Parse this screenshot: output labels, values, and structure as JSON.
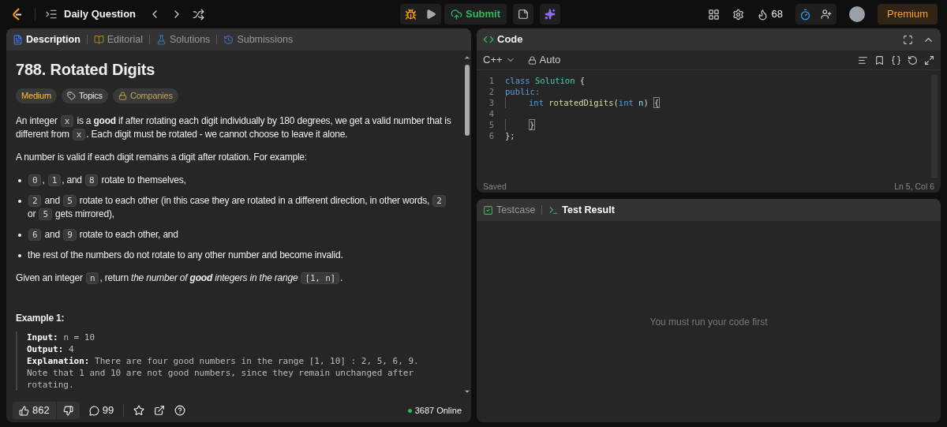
{
  "topbar": {
    "title": "Daily Question",
    "submit": "Submit",
    "streak": "68",
    "premium": "Premium"
  },
  "left_tabs": [
    {
      "kind": "description",
      "label": "Description",
      "selected": true
    },
    {
      "kind": "editorial",
      "label": "Editorial",
      "selected": false
    },
    {
      "kind": "solutions",
      "label": "Solutions",
      "selected": false
    },
    {
      "kind": "submissions",
      "label": "Submissions",
      "selected": false
    }
  ],
  "problem": {
    "title": "788. Rotated Digits",
    "tags": [
      {
        "kind": "difficulty",
        "label": "Medium"
      },
      {
        "kind": "topics",
        "label": "Topics"
      },
      {
        "kind": "companies",
        "label": "Companies"
      }
    ],
    "paragraphs": [
      [
        {
          "kind": "text",
          "text": "An integer "
        },
        {
          "kind": "code",
          "text": "x"
        },
        {
          "kind": "text",
          "text": " is a **good** if after rotating each digit individually by 180 degrees, we get a valid number that is different from "
        },
        {
          "kind": "code",
          "text": "x"
        },
        {
          "kind": "text",
          "text": ". Each digit must be rotated - we cannot choose to leave it alone."
        }
      ],
      [
        {
          "kind": "text",
          "text": "A number is valid if each digit remains a digit after rotation. For example:"
        }
      ]
    ],
    "bullets": [
      [
        {
          "kind": "code",
          "text": "0"
        },
        {
          "kind": "text",
          "text": ", "
        },
        {
          "kind": "code",
          "text": "1"
        },
        {
          "kind": "text",
          "text": ", and "
        },
        {
          "kind": "code",
          "text": "8"
        },
        {
          "kind": "text",
          "text": " rotate to themselves,"
        }
      ],
      [
        {
          "kind": "code",
          "text": "2"
        },
        {
          "kind": "text",
          "text": " and "
        },
        {
          "kind": "code",
          "text": "5"
        },
        {
          "kind": "text",
          "text": " rotate to each other (in this case they are rotated in a different direction, in other words, "
        },
        {
          "kind": "code",
          "text": "2"
        },
        {
          "kind": "text",
          "text": " or "
        },
        {
          "kind": "code",
          "text": "5"
        },
        {
          "kind": "text",
          "text": " gets mirrored),"
        }
      ],
      [
        {
          "kind": "code",
          "text": "6"
        },
        {
          "kind": "text",
          "text": " and "
        },
        {
          "kind": "code",
          "text": "9"
        },
        {
          "kind": "text",
          "text": " rotate to each other, and"
        }
      ],
      [
        {
          "kind": "text",
          "text": "the rest of the numbers do not rotate to any other number and become invalid."
        }
      ]
    ],
    "closing": [
      {
        "kind": "text",
        "text": "Given an integer "
      },
      {
        "kind": "code",
        "text": "n"
      },
      {
        "kind": "text",
        "text": ", return "
      },
      {
        "kind": "emphasis",
        "text": "the number of **good** integers in the range"
      },
      {
        "kind": "code",
        "text": "[1, n]"
      },
      {
        "kind": "text",
        "text": "."
      }
    ],
    "example": {
      "title": "Example 1:",
      "lines": [
        {
          "label": "Input:",
          "value": "n = 10"
        },
        {
          "label": "Output:",
          "value": "4"
        },
        {
          "label": "Explanation:",
          "value": "There are four good numbers in the range [1, 10] : 2, 5, 6, 9."
        },
        {
          "value": "Note that 1 and 10 are not good numbers, since they remain unchanged after"
        },
        {
          "value": "rotating."
        }
      ]
    }
  },
  "footer": {
    "likes": "862",
    "comments": "99",
    "online": "3687 Online"
  },
  "code_panel": {
    "title": "Code",
    "language": "C++",
    "mode": "Auto",
    "lines": [
      {
        "number": "1",
        "tokens": [
          {
            "kind": "keyword",
            "text": "class "
          },
          {
            "kind": "type",
            "text": "Solution"
          },
          {
            "kind": "plain",
            "text": " {"
          }
        ]
      },
      {
        "number": "2",
        "tokens": [
          {
            "kind": "keyword",
            "text": "public:"
          }
        ]
      },
      {
        "number": "3",
        "indented": true,
        "tokens": [
          {
            "kind": "keyword",
            "text": "int "
          },
          {
            "kind": "func",
            "text": "rotatedDigits"
          },
          {
            "kind": "plain",
            "text": "("
          },
          {
            "kind": "keyword",
            "text": "int "
          },
          {
            "kind": "var",
            "text": "n"
          },
          {
            "kind": "plain",
            "text": ") "
          },
          {
            "kind": "bracket",
            "text": "{"
          }
        ]
      },
      {
        "number": "4"
      },
      {
        "number": "5",
        "indented": true,
        "tokens": [
          {
            "kind": "bracket",
            "text": "}"
          }
        ]
      },
      {
        "number": "6",
        "tokens": [
          {
            "kind": "plain",
            "text": "};"
          }
        ]
      }
    ],
    "status": "Saved",
    "cursor": "Ln 5, Col 6"
  },
  "result_tabs": [
    {
      "kind": "testcase",
      "label": "Testcase",
      "selected": false
    },
    {
      "kind": "result",
      "label": "Test Result",
      "selected": true
    }
  ],
  "result_message": "You must run your code first"
}
